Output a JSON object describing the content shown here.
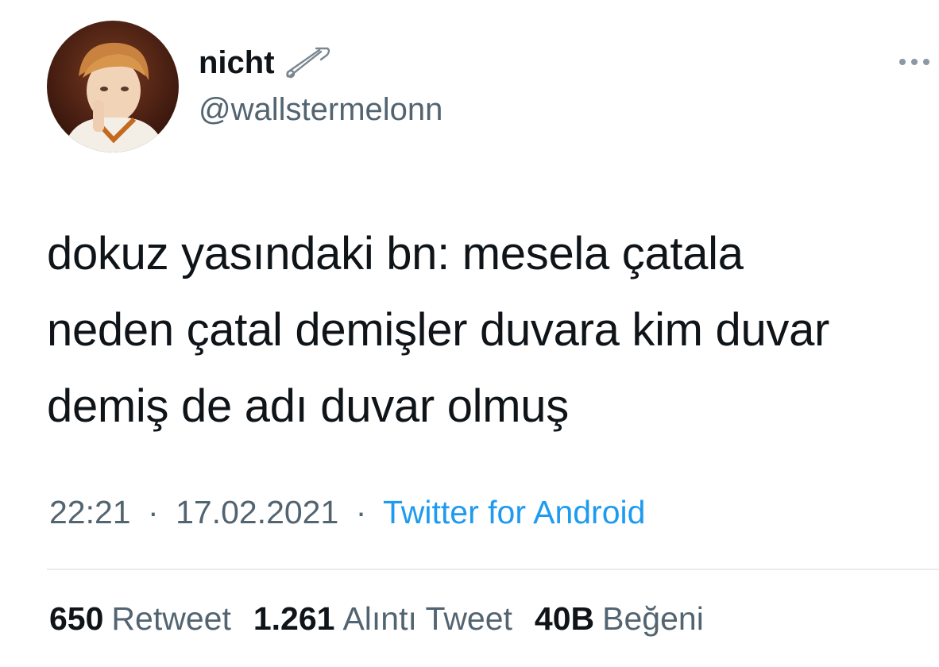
{
  "user": {
    "display_name": "nicht",
    "handle": "@wallstermelonn",
    "badge_icon": "safety-pin-icon"
  },
  "menu": {
    "icon": "more-dots-icon"
  },
  "tweet": {
    "lines": [
      "dokuz yasındaki bn: mesela çatala",
      "neden çatal demişler duvara kim duvar",
      "demiş de adı duvar olmuş"
    ],
    "time": "22:21",
    "date": "17.02.2021",
    "separator": "·",
    "source": "Twitter for Android"
  },
  "stats": {
    "retweets": {
      "count": "650",
      "label": "Retweet"
    },
    "quotes": {
      "count": "1.261",
      "label": "Alıntı Tweet"
    },
    "likes": {
      "count": "40B",
      "label": "Beğeni"
    }
  },
  "colors": {
    "text": "#0f1419",
    "secondary": "#536471",
    "link": "#1d9bf0",
    "divider": "#e6ecf0"
  }
}
